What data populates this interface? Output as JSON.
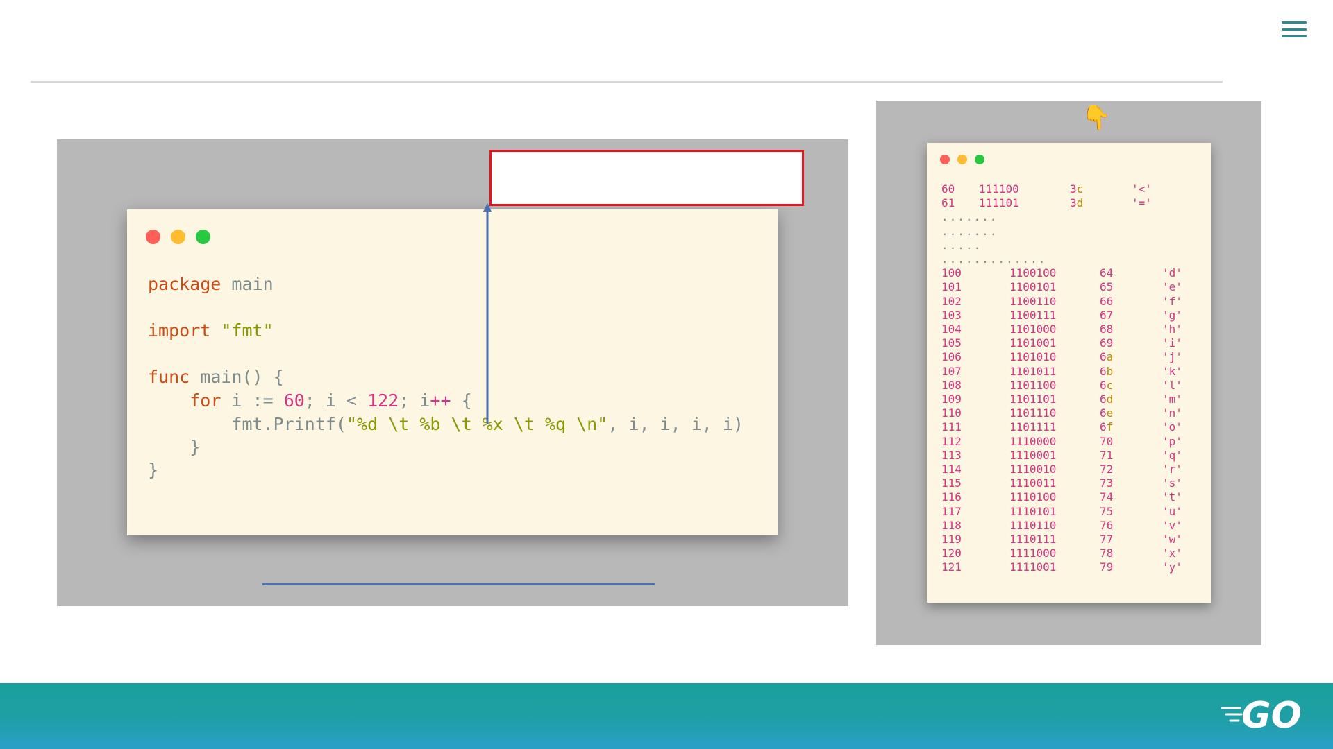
{
  "colors": {
    "accent": "#2a8c8f",
    "keyword": "#cb4b16",
    "string": "#859900",
    "number": "#d33682",
    "highlight_box": "#e8141c",
    "arrow": "#4a6fb5"
  },
  "header": {
    "menu_icon": "hamburger-menu-icon"
  },
  "code_window": {
    "lines": [
      {
        "kw": "package",
        "rest": " main"
      },
      {
        "kw": "import",
        "str": " \"fmt\""
      },
      {
        "kw": "func",
        "rest": " main() {"
      },
      {
        "indent": "    ",
        "kw": "for",
        "a": " i := ",
        "n1": "60",
        "b": "; i < ",
        "n2": "122",
        "c": "; i",
        "op": "++",
        "d": " {"
      },
      {
        "indent": "        ",
        "a": "fmt.Printf(",
        "str": "\"%d \\t %b \\t %x \\t %q \\n\"",
        "b": ", i, i, i, i)"
      },
      {
        "rest": "    }"
      },
      {
        "rest": "}"
      }
    ]
  },
  "output_window": {
    "pointer_icon": "pointing-down-hand-icon",
    "top_rows": [
      {
        "dec": "60",
        "bin": "111100",
        "hex_d": "3",
        "hex_l": "c",
        "chr": "'<'"
      },
      {
        "dec": "61",
        "bin": "111101",
        "hex_d": "3",
        "hex_l": "d",
        "chr": "'='"
      }
    ],
    "ellipses": [
      ".......",
      ".......",
      ".....",
      "............."
    ],
    "rows": [
      {
        "dec": "100",
        "bin": "1100100",
        "hex_d": "64",
        "hex_l": "",
        "chr": "'d'"
      },
      {
        "dec": "101",
        "bin": "1100101",
        "hex_d": "65",
        "hex_l": "",
        "chr": "'e'"
      },
      {
        "dec": "102",
        "bin": "1100110",
        "hex_d": "66",
        "hex_l": "",
        "chr": "'f'"
      },
      {
        "dec": "103",
        "bin": "1100111",
        "hex_d": "67",
        "hex_l": "",
        "chr": "'g'"
      },
      {
        "dec": "104",
        "bin": "1101000",
        "hex_d": "68",
        "hex_l": "",
        "chr": "'h'"
      },
      {
        "dec": "105",
        "bin": "1101001",
        "hex_d": "69",
        "hex_l": "",
        "chr": "'i'"
      },
      {
        "dec": "106",
        "bin": "1101010",
        "hex_d": "6",
        "hex_l": "a",
        "chr": "'j'"
      },
      {
        "dec": "107",
        "bin": "1101011",
        "hex_d": "6",
        "hex_l": "b",
        "chr": "'k'"
      },
      {
        "dec": "108",
        "bin": "1101100",
        "hex_d": "6",
        "hex_l": "c",
        "chr": "'l'"
      },
      {
        "dec": "109",
        "bin": "1101101",
        "hex_d": "6",
        "hex_l": "d",
        "chr": "'m'"
      },
      {
        "dec": "110",
        "bin": "1101110",
        "hex_d": "6",
        "hex_l": "e",
        "chr": "'n'"
      },
      {
        "dec": "111",
        "bin": "1101111",
        "hex_d": "6",
        "hex_l": "f",
        "chr": "'o'"
      },
      {
        "dec": "112",
        "bin": "1110000",
        "hex_d": "70",
        "hex_l": "",
        "chr": "'p'"
      },
      {
        "dec": "113",
        "bin": "1110001",
        "hex_d": "71",
        "hex_l": "",
        "chr": "'q'"
      },
      {
        "dec": "114",
        "bin": "1110010",
        "hex_d": "72",
        "hex_l": "",
        "chr": "'r'"
      },
      {
        "dec": "115",
        "bin": "1110011",
        "hex_d": "73",
        "hex_l": "",
        "chr": "'s'"
      },
      {
        "dec": "116",
        "bin": "1110100",
        "hex_d": "74",
        "hex_l": "",
        "chr": "'t'"
      },
      {
        "dec": "117",
        "bin": "1110101",
        "hex_d": "75",
        "hex_l": "",
        "chr": "'u'"
      },
      {
        "dec": "118",
        "bin": "1110110",
        "hex_d": "76",
        "hex_l": "",
        "chr": "'v'"
      },
      {
        "dec": "119",
        "bin": "1110111",
        "hex_d": "77",
        "hex_l": "",
        "chr": "'w'"
      },
      {
        "dec": "120",
        "bin": "1111000",
        "hex_d": "78",
        "hex_l": "",
        "chr": "'x'"
      },
      {
        "dec": "121",
        "bin": "1111001",
        "hex_d": "79",
        "hex_l": "",
        "chr": "'y'"
      }
    ]
  },
  "footer": {
    "logo": "GO"
  }
}
